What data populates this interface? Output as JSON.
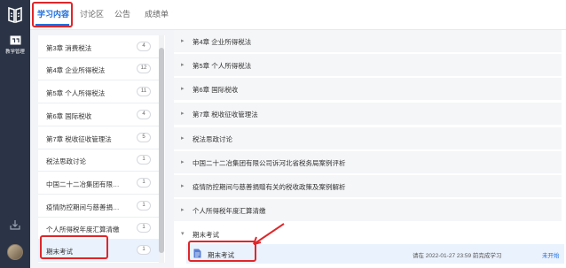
{
  "nav": {
    "rail_label": "教学管理"
  },
  "tabs": [
    {
      "label": "学习内容"
    },
    {
      "label": "讨论区"
    },
    {
      "label": "公告"
    },
    {
      "label": "成绩单"
    }
  ],
  "chapter_list": [
    {
      "label": "第3章 消费税法",
      "count": "4"
    },
    {
      "label": "第4章 企业所得税法",
      "count": "12"
    },
    {
      "label": "第5章 个人所得税法",
      "count": "11"
    },
    {
      "label": "第6章 国际税收",
      "count": "4"
    },
    {
      "label": "第7章 税收征收管理法",
      "count": "5"
    },
    {
      "label": "税法思政讨论",
      "count": "1"
    },
    {
      "label": "中国二十二冶集团有限…",
      "count": "1"
    },
    {
      "label": "疫情防控期间与慈善捐…",
      "count": "1"
    },
    {
      "label": "个人所得税年度汇算清缴",
      "count": "1"
    },
    {
      "label": "期末考试",
      "count": "1"
    }
  ],
  "content_chapters": [
    {
      "label": "第4章 企业所得税法"
    },
    {
      "label": "第5章 个人所得税法"
    },
    {
      "label": "第6章 国际税收"
    },
    {
      "label": "第7章 税收征收管理法"
    },
    {
      "label": "税法思政讨论"
    },
    {
      "label": "中国二十二冶集团有限公司诉河北省税务局案例评析"
    },
    {
      "label": "疫情防控期间与慈善捐赠有关的税收政策及案例解析"
    },
    {
      "label": "个人所得税年度汇算清缴"
    },
    {
      "label": "期末考试"
    }
  ],
  "sub_item": {
    "title": "期末考试",
    "deadline": "请在 2022-01-27 23:59 前完成学习",
    "status": "未开始"
  },
  "colors": {
    "accent": "#1e6fe0",
    "highlight_box": "#e0262a",
    "rail": "#2b3446"
  }
}
